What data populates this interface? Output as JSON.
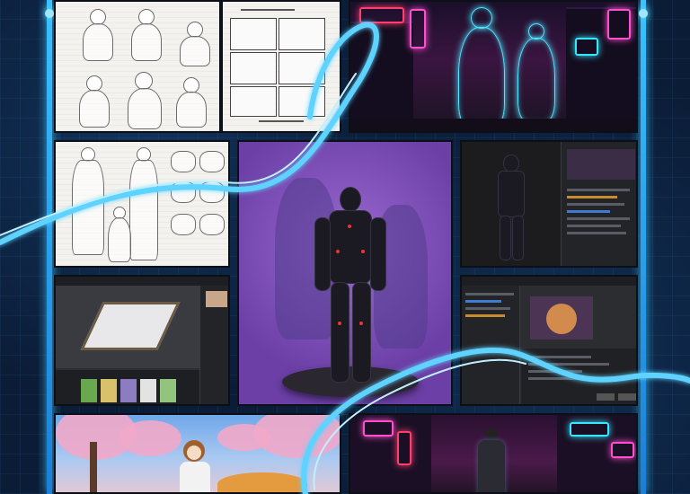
{
  "description_free": true,
  "colors": {
    "background": "#0b1c36",
    "rail": "#39c2ff",
    "ribbon": "#5fd3ff",
    "mocap_backdrop": "#8a5bc7",
    "hologram": "#4ee6ff"
  },
  "panels": [
    {
      "id": "character-turnaround-sketch",
      "kind": "sketch"
    },
    {
      "id": "storyboard-sketch",
      "kind": "sketch"
    },
    {
      "id": "cyber-city-hologram",
      "kind": "render"
    },
    {
      "id": "body-proportion-sketch",
      "kind": "sketch"
    },
    {
      "id": "mocap-suit-purple",
      "kind": "render"
    },
    {
      "id": "mocap-software-dark",
      "kind": "app"
    },
    {
      "id": "layout-3d-software",
      "kind": "app"
    },
    {
      "id": "compositing-software",
      "kind": "app"
    },
    {
      "id": "anime-blossom-scene",
      "kind": "render"
    },
    {
      "id": "neon-alley-scene",
      "kind": "render"
    }
  ]
}
